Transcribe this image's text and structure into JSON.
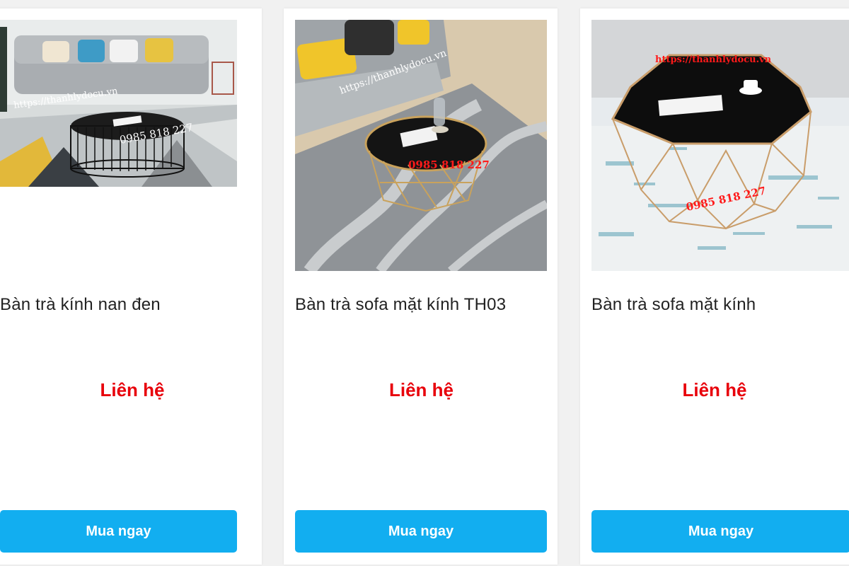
{
  "products": [
    {
      "title": "Bàn trà kính nan đen",
      "price": "Liên hệ",
      "button": "Mua ngay",
      "image": {
        "watermark_url": "https://thanhlydocu.vn",
        "watermark_phone": "0985 818 227"
      }
    },
    {
      "title": "Bàn trà sofa mặt kính TH03",
      "price": "Liên hệ",
      "button": "Mua ngay",
      "image": {
        "watermark_url": "https://thanhlydocu.vn",
        "watermark_phone": "0985 818 227"
      }
    },
    {
      "title": "Bàn trà sofa mặt kính",
      "price": "Liên hệ",
      "button": "Mua ngay",
      "image": {
        "watermark_url": "https://thanhlydocu.vn",
        "watermark_phone": "0985 818 227"
      }
    }
  ],
  "colors": {
    "price": "#e8000b",
    "button_bg": "#12aef0",
    "button_text": "#ffffff",
    "title": "#222222"
  }
}
